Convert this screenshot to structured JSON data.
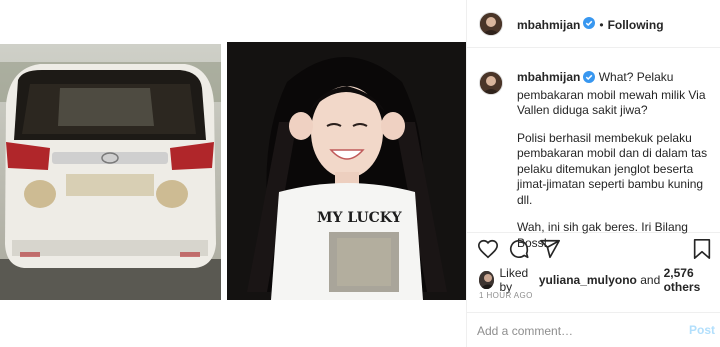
{
  "header": {
    "username": "mbahmijan",
    "separator": "•",
    "follow_status": "Following"
  },
  "caption": {
    "username": "mbahmijan",
    "paragraphs": [
      "What? Pelaku pembakaran mobil mewah milik Via Vallen diduga sakit jiwa?",
      "Polisi berhasil membekuk pelaku pembakaran mobil dan di dalam tas pelaku ditemukan jenglot beserta jimat-jimatan seperti bambu kuning dll.",
      "Wah, ini sih gak beres. Iri Bilang Boss!"
    ]
  },
  "media": {
    "shirt_text": "MY LUCKY"
  },
  "likes": {
    "prefix": "Liked by",
    "user": "yuliana_mulyono",
    "and": "and",
    "others": "2,576 others"
  },
  "timestamp": "1 HOUR AGO",
  "comment": {
    "placeholder": "Add a comment…",
    "post_label": "Post"
  },
  "icons": [
    "heart-icon",
    "comment-icon",
    "share-icon",
    "bookmark-icon",
    "verified-badge-icon"
  ],
  "colors": {
    "text": "#262626",
    "muted": "#8e8e8e",
    "border": "#efefef",
    "verified": "#3897f0",
    "post_disabled": "#b2dffc"
  }
}
